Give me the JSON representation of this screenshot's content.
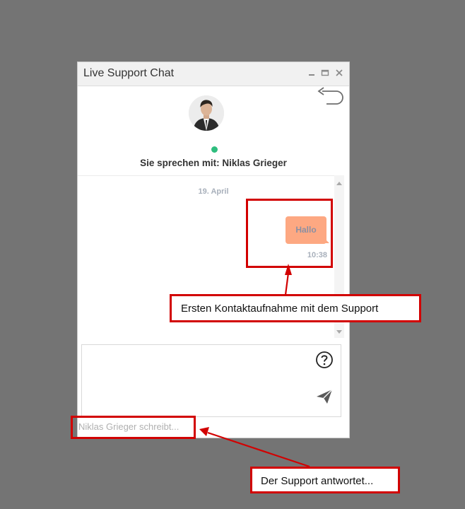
{
  "window": {
    "title": "Live Support Chat",
    "controls": [
      "minimize-icon",
      "maximize-icon",
      "close-icon"
    ]
  },
  "header": {
    "back_icon": "back-arrow-icon",
    "avatar": "agent-avatar",
    "status_color": "#2ebd7e",
    "agent_line": "Sie sprechen mit: Niklas Grieger"
  },
  "messages": {
    "date": "19. April",
    "items": [
      {
        "text": "Hallo",
        "time": "10:38",
        "bubble_color": "#fda882"
      }
    ]
  },
  "composer": {
    "help_icon": "help-icon",
    "send_icon": "send-icon"
  },
  "typing_indicator": "Niklas Grieger schreibt...",
  "annotations": {
    "callout_first_contact": "Ersten Kontaktaufnahme mit dem Support",
    "callout_reply": "Der Support antwortet...",
    "highlight_color": "#d20000"
  }
}
